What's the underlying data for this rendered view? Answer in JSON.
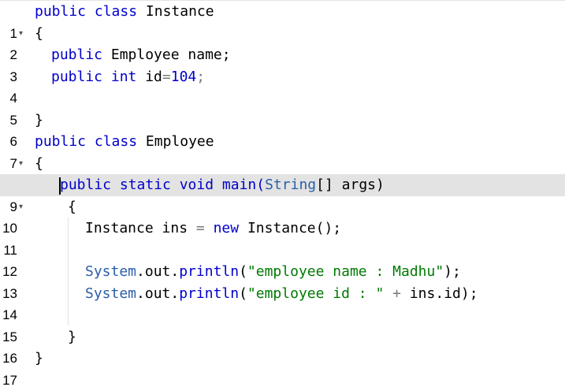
{
  "editor": {
    "lines": [
      {
        "n": "1"
      },
      {
        "n": "2"
      },
      {
        "n": "3"
      },
      {
        "n": "4"
      },
      {
        "n": "5"
      },
      {
        "n": "6"
      },
      {
        "n": "7"
      },
      {
        "n": "8"
      },
      {
        "n": "9"
      },
      {
        "n": "10"
      },
      {
        "n": "11"
      },
      {
        "n": "12"
      },
      {
        "n": "13"
      },
      {
        "n": "14"
      },
      {
        "n": "15"
      },
      {
        "n": "16"
      },
      {
        "n": "17"
      }
    ],
    "fold_icon": "chevron-down-icon",
    "tokens": {
      "l1_kw": "public class",
      "l1_name": "Instance",
      "l2_brace": "{",
      "l3_kw": "public",
      "l3_rest": "Employee name;",
      "l4_kw": "public int",
      "l4_id": "id",
      "l4_eq": "=",
      "l4_num": "104",
      "l4_semi": ";",
      "l6_brace": "}",
      "l7_kw": "public class",
      "l7_name": "Employee",
      "l8_brace": "{",
      "l9_kw": "public static void",
      "l9_main": "main(",
      "l9_string": "String",
      "l9_rest": "[] args)",
      "l10_brace": "{",
      "l11_a": "Instance ins",
      "l11_eq": "=",
      "l11_new": "new",
      "l11_b": "Instance();",
      "l13_sys": "System",
      "l13_out": ".out.",
      "l13_println": "println",
      "l13_open": "(",
      "l13_str": "\"employee name : Madhu\"",
      "l13_close": ");",
      "l14_sys": "System",
      "l14_out": ".out.",
      "l14_println": "println",
      "l14_open": "(",
      "l14_str": "\"employee id : \"",
      "l14_plus": "+",
      "l14_rest": "ins.id);",
      "l16_brace": "}",
      "l17_brace": "}"
    },
    "colors": {
      "keyword": "#0000cc",
      "string": "#007a00",
      "active_line": "#e3e3e3"
    }
  }
}
